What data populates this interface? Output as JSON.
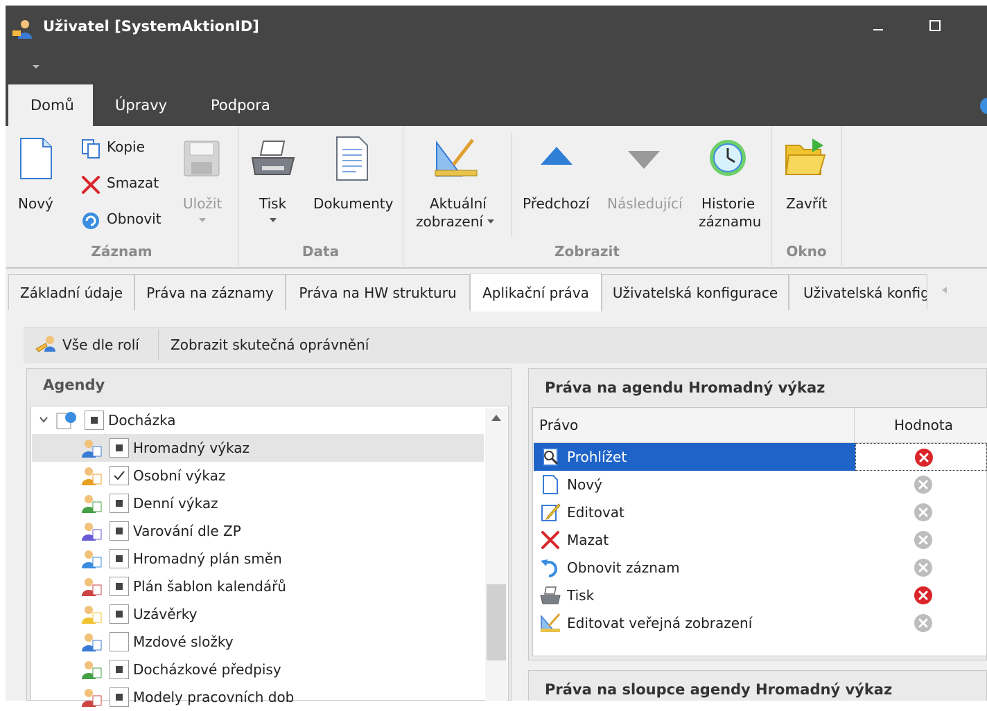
{
  "window": {
    "title": "Uživatel [SystemAktionID]"
  },
  "ribbon_tabs": [
    "Domů",
    "Úpravy",
    "Podpora"
  ],
  "ribbon": {
    "novy": "Nový",
    "kopie": "Kopie",
    "smazat": "Smazat",
    "obnovit": "Obnovit",
    "ulozit": "Uložit",
    "tisk": "Tisk",
    "dokumenty": "Dokumenty",
    "aktualni1": "Aktuální",
    "aktualni2": "zobrazení",
    "predchozi": "Předchozí",
    "nasledujici": "Následující",
    "historie1": "Historie",
    "historie2": "záznamu",
    "zavrit": "Zavřít",
    "groups": {
      "zaznam": "Záznam",
      "data": "Data",
      "zobrazit": "Zobrazit",
      "okno": "Okno"
    }
  },
  "content_tabs": [
    "Základní údaje",
    "Práva na záznamy",
    "Práva na HW strukturu",
    "Aplikační práva",
    "Uživatelská konfigurace",
    "Uživatelská konfig"
  ],
  "toolbar": {
    "vse_dle_roli": "Vše dle rolí",
    "zobrazit_opravneni": "Zobrazit skutečná oprávnění"
  },
  "agendy": {
    "title": "Agendy",
    "root": "Docházka",
    "items": [
      {
        "label": "Hromadný výkaz",
        "state": "partial",
        "icon": "group-users-icon"
      },
      {
        "label": "Osobní výkaz",
        "state": "checked",
        "icon": "user-icon"
      },
      {
        "label": "Denní výkaz",
        "state": "partial",
        "icon": "group-calendar-icon"
      },
      {
        "label": "Varování dle ZP",
        "state": "partial",
        "icon": "paragraph-icon"
      },
      {
        "label": "Hromadný plán směn",
        "state": "partial",
        "icon": "globe-clock-icon"
      },
      {
        "label": "Plán šablon kalendářů",
        "state": "partial",
        "icon": "calendar-globe-icon"
      },
      {
        "label": "Uzávěrky",
        "state": "partial",
        "icon": "lock-check-icon"
      },
      {
        "label": "Mzdové složky",
        "state": "unchecked",
        "icon": "blocks-icon"
      },
      {
        "label": "Docházkové předpisy",
        "state": "partial",
        "icon": "calendar-rule-icon"
      },
      {
        "label": "Modely pracovních dob",
        "state": "partial",
        "icon": "schedule-model-icon"
      }
    ]
  },
  "prava": {
    "title": "Práva na agendu Hromadný výkaz",
    "col_pravo": "Právo",
    "col_hodnota": "Hodnota",
    "rows": [
      {
        "label": "Prohlížet",
        "value": "denied",
        "icon": "view-icon"
      },
      {
        "label": "Nový",
        "value": "inherited",
        "icon": "new-doc-icon"
      },
      {
        "label": "Editovat",
        "value": "inherited",
        "icon": "edit-icon"
      },
      {
        "label": "Mazat",
        "value": "inherited",
        "icon": "delete-icon"
      },
      {
        "label": "Obnovit záznam",
        "value": "inherited",
        "icon": "refresh-icon"
      },
      {
        "label": "Tisk",
        "value": "denied",
        "icon": "printer-icon"
      },
      {
        "label": "Editovat veřejná zobrazení",
        "value": "inherited",
        "icon": "edit-view-icon"
      }
    ]
  },
  "sloupce": {
    "title": "Práva na sloupce agendy Hromadný výkaz"
  },
  "colors": {
    "titlebar": "#454545",
    "selection": "#1e64c8",
    "denied": "#d9262b",
    "inherited": "#bdbdbd"
  }
}
